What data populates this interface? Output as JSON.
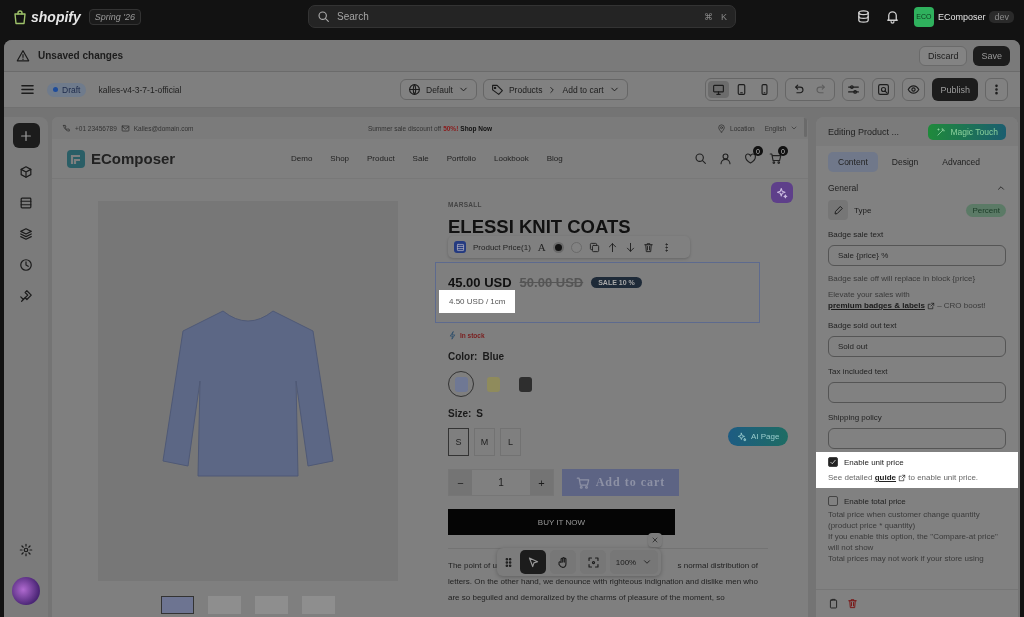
{
  "topbar": {
    "logo": "shopify",
    "edition": "Spring '26",
    "search": {
      "placeholder": "Search"
    },
    "shortcut": [
      "⌘",
      "K"
    ],
    "avatar": "ECO",
    "store": "EComposer",
    "store_badge": "dev"
  },
  "status_bar": {
    "message": "Unsaved changes",
    "buttons": [
      {
        "label": "Discard",
        "kind": "secondary"
      },
      {
        "label": "Save",
        "kind": "primary"
      }
    ]
  },
  "toolbar": {
    "status": "Draft",
    "theme": "kalles-v4-3-7-1-official",
    "template": "Default",
    "breadcrumb": [
      "Products",
      "Add to cart"
    ],
    "devices": [
      {
        "kind": "desktop",
        "selected": true
      },
      {
        "kind": "tablet",
        "selected": false
      },
      {
        "kind": "mobile",
        "selected": false
      }
    ],
    "publish": "Publish"
  },
  "store": {
    "announcement": {
      "phone": "+01 23456789",
      "email": "Kalles@domain.com",
      "promo": "Summer sale discount off",
      "promo_highlight": "50%!",
      "promo_link": "Shop Now",
      "location": "Location",
      "language": "English"
    },
    "nav": {
      "logo": "EComposer",
      "items": [
        "Demo",
        "Shop",
        "Product",
        "Sale",
        "Portfolio",
        "Lookbook",
        "Blog"
      ],
      "wishlist_count": "0",
      "cart_count": "0"
    }
  },
  "product": {
    "vendor": "MARSALL",
    "title": "ELESSI KNIT COATS",
    "block_toolbar": {
      "label": "Product Price(1)",
      "format_glyph": "A"
    },
    "price": "45.00 USD",
    "compare_price": "50.00 USD",
    "sale_badge": "SALE 10 %",
    "unit_price": "4.50 USD / 1cm",
    "stock": "In stock",
    "color_label": "Color:",
    "color_value": "Blue",
    "swatches": [
      {
        "color": "#6f7894",
        "selected": true
      },
      {
        "color": "#8f8b5c",
        "selected": false
      },
      {
        "color": "#2e2e2e",
        "selected": false
      }
    ],
    "size_label": "Size:",
    "size_value": "S",
    "sizes": [
      {
        "label": "S",
        "selected": true
      },
      {
        "label": "M",
        "selected": false
      },
      {
        "label": "L",
        "selected": false
      }
    ],
    "quantity": "1",
    "minus": "−",
    "plus": "+",
    "add_to_cart": "Add to cart",
    "buy_now": "BUY IT NOW",
    "description_start": "The point of u",
    "description_end": "s normal distribution of",
    "description_rest": "letters. On the other hand, we denounce with righteous indignation and dislike men who are so beguiled and demoralized by the charms of pleasure of the moment, so",
    "thumbnails": [
      {
        "selected": true
      },
      {
        "selected": false
      },
      {
        "selected": false
      },
      {
        "selected": false
      }
    ]
  },
  "ai_button": "AI Page",
  "view_tools": {
    "tools": [
      {
        "kind": "drag",
        "selected": false
      },
      {
        "kind": "pointer",
        "selected": true
      },
      {
        "kind": "hand",
        "selected": false
      },
      {
        "kind": "focus",
        "selected": false
      }
    ],
    "zoom": "100%"
  },
  "panel": {
    "title": "Editing Product ...",
    "magic": "Magic Touch",
    "tabs": [
      {
        "label": "Content",
        "selected": true
      },
      {
        "label": "Design",
        "selected": false
      },
      {
        "label": "Advanced",
        "selected": false
      }
    ],
    "section": {
      "title": "General",
      "expanded": true
    },
    "type": {
      "label": "Type",
      "value": "Percent"
    },
    "items": [
      {
        "kind": "field",
        "label": "Badge sale text",
        "value": "Sale {price} %"
      },
      {
        "kind": "hint",
        "text": "Badge sale off will replace in block {price}"
      },
      {
        "kind": "promo",
        "before": "Elevate your sales with",
        "link": "premium badges & labels",
        "after": "– CRO boost!"
      },
      {
        "kind": "field",
        "label": "Badge sold out text",
        "value": "Sold out"
      },
      {
        "kind": "field",
        "label": "Tax included text"
      },
      {
        "kind": "field",
        "label": "Shipping policy"
      },
      {
        "kind": "checkbox",
        "label": "Enable unit price",
        "checked": true,
        "highlighted": true,
        "note": {
          "before": "See detailed",
          "link": "guide",
          "after": "to enable unit price."
        }
      },
      {
        "kind": "checkbox",
        "label": "Enable total price",
        "checked": false,
        "highlighted": false
      },
      {
        "kind": "paragraph",
        "lines": [
          "Total price when customer change quantity (product price * quantity)",
          "If you enable this option, the \"Compare-at price\" will not show",
          "Total prices may not work if your store using"
        ]
      }
    ]
  }
}
